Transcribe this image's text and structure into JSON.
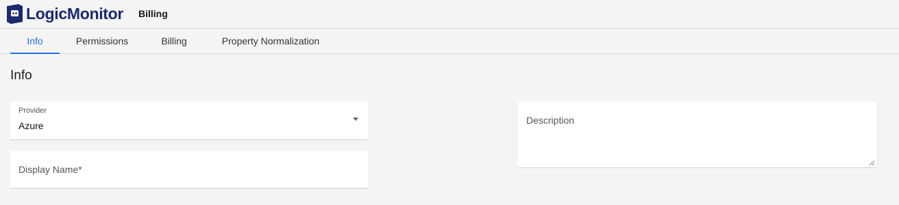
{
  "app": {
    "logo_text": "LogicMonitor",
    "page_heading": "Billing",
    "brand_color": "#1b2a6b",
    "accent_color": "#1f6fd9"
  },
  "tabs": [
    {
      "label": "Info",
      "active": true
    },
    {
      "label": "Permissions",
      "active": false
    },
    {
      "label": "Billing",
      "active": false
    },
    {
      "label": "Property Normalization",
      "active": false
    }
  ],
  "section": {
    "title": "Info"
  },
  "form": {
    "provider": {
      "label": "Provider",
      "value": "Azure",
      "icon": "chevron-down-icon"
    },
    "display_name": {
      "label": "Display Name*",
      "value": ""
    },
    "description": {
      "label": "Description",
      "value": ""
    }
  }
}
